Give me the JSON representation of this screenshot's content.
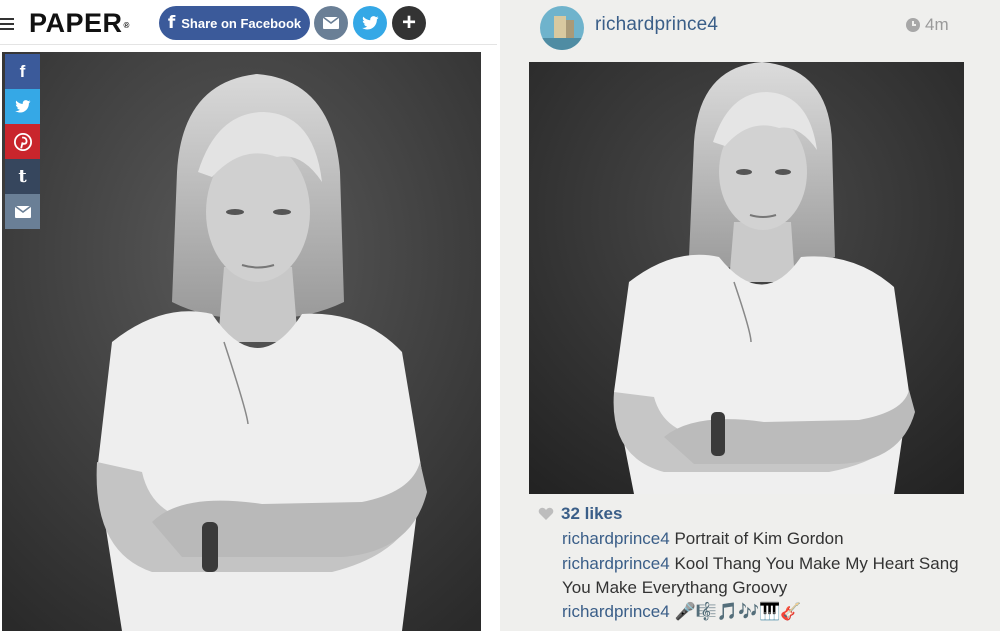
{
  "left": {
    "menu_icon": "hamburger-icon",
    "logo": "PAPER",
    "logo_mark": "®",
    "share_facebook_label": "Share on Facebook",
    "facebook_glyph": "f",
    "plus_glyph": "+",
    "rail": {
      "facebook_glyph": "f",
      "tumblr_glyph": "t"
    }
  },
  "right": {
    "username": "richardprince4",
    "time": "4m",
    "likes": "32 likes",
    "comments": [
      {
        "user": "richardprince4",
        "text": "Portrait of Kim Gordon"
      },
      {
        "user": "richardprince4",
        "text": "Kool Thang You Make My Heart Sang You Make Everythang Groovy"
      },
      {
        "user": "richardprince4",
        "text": "🎤🎼🎵🎶🎹🎸"
      }
    ]
  },
  "colors": {
    "facebook": "#3b5a9a",
    "twitter": "#35a8e6",
    "pinterest": "#c9252c",
    "tumblr": "#36465d",
    "mail": "#6a7f96",
    "instagram_link": "#3a5e88"
  }
}
